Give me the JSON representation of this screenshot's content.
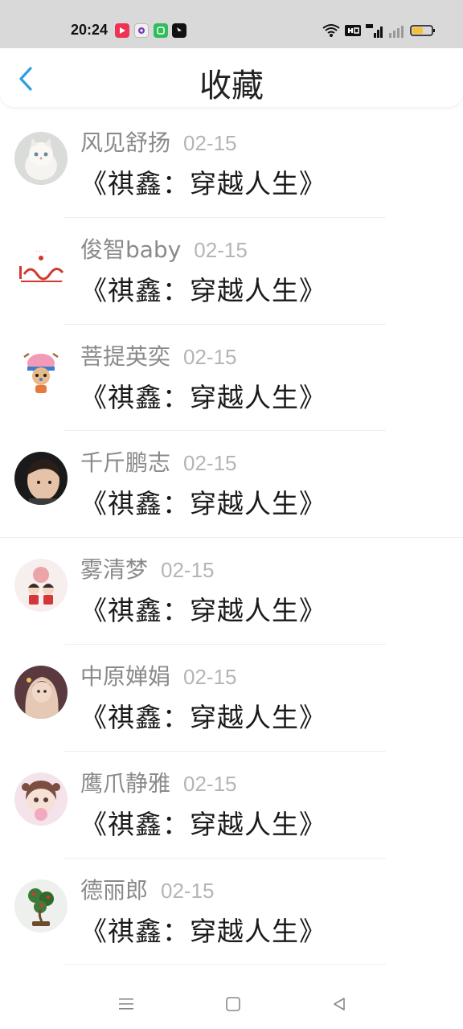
{
  "status_bar": {
    "time": "20:24",
    "icons": [
      "media-app-icon",
      "circle-app-icon",
      "green-app-icon",
      "black-app-icon",
      "wifi-icon",
      "hd-icon",
      "signal-5g-icon",
      "signal-icon",
      "battery-icon"
    ]
  },
  "header": {
    "title": "收藏",
    "back_icon": "back-chevron-icon",
    "accent_color": "#2d9fe0"
  },
  "favorites": [
    {
      "name": "风见舒扬",
      "date": "02-15",
      "book": "《祺鑫：穿越人生》",
      "avatar": "white-cat-avatar"
    },
    {
      "name": "俊智baby",
      "date": "02-15",
      "book": "《祺鑫：穿越人生》",
      "avatar": "red-logo-avatar"
    },
    {
      "name": "菩提英奕",
      "date": "02-15",
      "book": "《祺鑫：穿越人生》",
      "avatar": "chopper-avatar"
    },
    {
      "name": "千斤鹏志",
      "date": "02-15",
      "book": "《祺鑫：穿越人生》",
      "avatar": "child-photo-avatar"
    },
    {
      "name": "雾清梦",
      "date": "02-15",
      "book": "《祺鑫：穿越人生》",
      "avatar": "cartoon-couple-avatar"
    },
    {
      "name": "中原婵娟",
      "date": "02-15",
      "book": "《祺鑫：穿越人生》",
      "avatar": "anime-girl-avatar"
    },
    {
      "name": "鹰爪静雅",
      "date": "02-15",
      "book": "《祺鑫：穿越人生》",
      "avatar": "pink-anime-avatar"
    },
    {
      "name": "德丽郎",
      "date": "02-15",
      "book": "《祺鑫：穿越人生》",
      "avatar": "bonsai-avatar"
    }
  ],
  "nav_bar": {
    "icons": [
      "menu-icon",
      "home-icon",
      "back-triangle-icon"
    ]
  }
}
